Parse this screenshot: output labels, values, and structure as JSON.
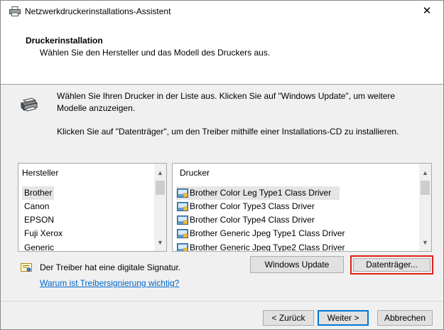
{
  "window": {
    "title": "Netzwerkdruckerinstallations-Assistent",
    "close_symbol": "✕"
  },
  "header": {
    "title": "Druckerinstallation",
    "subtitle": "Wählen Sie den Hersteller und das Modell des Druckers aus."
  },
  "info": {
    "text1": "Wählen Sie Ihren Drucker in der Liste aus. Klicken Sie auf \"Windows Update\", um weitere Modelle anzuzeigen.",
    "text2": "Klicken Sie auf \"Datenträger\", um den Treiber mithilfe einer Installations-CD zu installieren."
  },
  "manufacturers": {
    "header": "Hersteller",
    "items": [
      "Brother",
      "Canon",
      "EPSON",
      "Fuji Xerox",
      "Generic"
    ],
    "selected": "Brother"
  },
  "printers": {
    "header": "Drucker",
    "items": [
      "Brother Color Leg Type1 Class Driver",
      "Brother Color Type3 Class Driver",
      "Brother Color Type4 Class Driver",
      "Brother Generic Jpeg Type1 Class Driver",
      "Brother Generic Jpeg Type2 Class Driver"
    ],
    "selected": "Brother Color Leg Type1 Class Driver"
  },
  "signature": {
    "text": "Der Treiber hat eine digitale Signatur.",
    "link": "Warum ist Treibersignierung wichtig?"
  },
  "buttons": {
    "windows_update": "Windows Update",
    "have_disk": "Datenträger...",
    "back": "< Zurück",
    "next": "Weiter >",
    "cancel": "Abbrechen"
  },
  "icons": {
    "title": "printer-icon",
    "info": "printer-icon",
    "driver": "driver-icon",
    "signature": "certificate-icon"
  },
  "colors": {
    "link": "#0066cc",
    "highlight_outline": "#e0201b",
    "default_button_border": "#0078d7"
  }
}
